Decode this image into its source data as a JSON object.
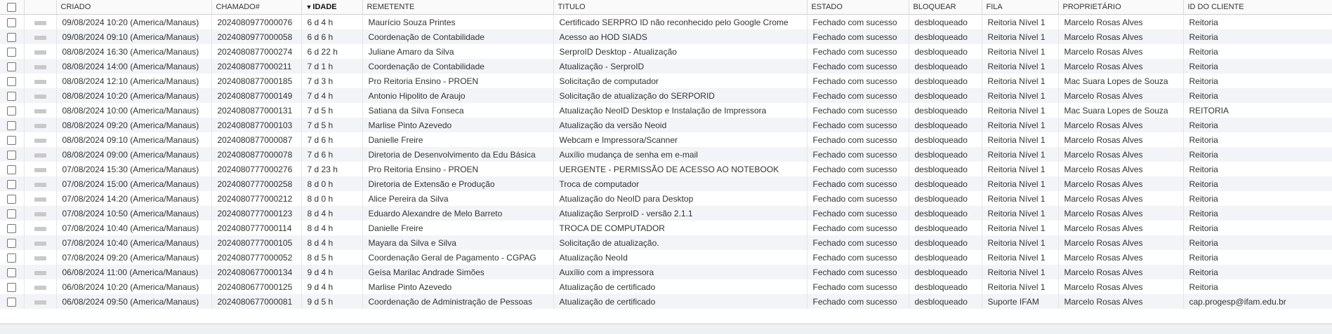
{
  "headers": {
    "created": "CRIADO",
    "ticket": "CHAMADO#",
    "age_sort_arrow": "▼",
    "age": "IDADE",
    "sender": "REMETENTE",
    "title": "TITULO",
    "state": "ESTADO",
    "lock": "BLOQUEAR",
    "queue": "FILA",
    "owner": "PROPRIETÁRIO",
    "customer_id": "ID DO CLIENTE"
  },
  "rows": [
    {
      "created": "09/08/2024 10:20 (America/Manaus)",
      "ticket": "2024080977000076",
      "age": "6 d 4 h",
      "sender": "Maurício Souza Printes",
      "title": "Certificado SERPRO ID não reconhecido pelo Google Crome",
      "state": "Fechado com sucesso",
      "lock": "desbloqueado",
      "queue": "Reitoria Nível 1",
      "owner": "Marcelo Rosas Alves",
      "customer_id": "Reitoria"
    },
    {
      "created": "09/08/2024 09:10 (America/Manaus)",
      "ticket": "2024080977000058",
      "age": "6 d 6 h",
      "sender": "Coordenação de Contabilidade",
      "title": "Acesso ao HOD SIADS",
      "state": "Fechado com sucesso",
      "lock": "desbloqueado",
      "queue": "Reitoria Nível 1",
      "owner": "Marcelo Rosas Alves",
      "customer_id": "Reitoria"
    },
    {
      "created": "08/08/2024 16:30 (America/Manaus)",
      "ticket": "2024080877000274",
      "age": "6 d 22 h",
      "sender": "Juliane Amaro da Silva",
      "title": "SerproID Desktop - Atualização",
      "state": "Fechado com sucesso",
      "lock": "desbloqueado",
      "queue": "Reitoria Nível 1",
      "owner": "Marcelo Rosas Alves",
      "customer_id": "Reitoria"
    },
    {
      "created": "08/08/2024 14:00 (America/Manaus)",
      "ticket": "2024080877000211",
      "age": "7 d 1 h",
      "sender": "Coordenação de Contabilidade",
      "title": "Atualização - SerproID",
      "state": "Fechado com sucesso",
      "lock": "desbloqueado",
      "queue": "Reitoria Nível 1",
      "owner": "Marcelo Rosas Alves",
      "customer_id": "Reitoria"
    },
    {
      "created": "08/08/2024 12:10 (America/Manaus)",
      "ticket": "2024080877000185",
      "age": "7 d 3 h",
      "sender": "Pro Reitoria Ensino - PROEN",
      "title": "Solicitação de computador",
      "state": "Fechado com sucesso",
      "lock": "desbloqueado",
      "queue": "Reitoria Nível 1",
      "owner": "Mac Suara Lopes de Souza",
      "customer_id": "Reitoria"
    },
    {
      "created": "08/08/2024 10:20 (America/Manaus)",
      "ticket": "2024080877000149",
      "age": "7 d 4 h",
      "sender": "Antonio Hipolito de Araujo",
      "title": "Solicitação de atualização do SERPORID",
      "state": "Fechado com sucesso",
      "lock": "desbloqueado",
      "queue": "Reitoria Nível 1",
      "owner": "Marcelo Rosas Alves",
      "customer_id": "Reitoria"
    },
    {
      "created": "08/08/2024 10:00 (America/Manaus)",
      "ticket": "2024080877000131",
      "age": "7 d 5 h",
      "sender": "Satiana da Silva Fonseca",
      "title": "Atualização NeoID Desktop e Instalação de Impressora",
      "state": "Fechado com sucesso",
      "lock": "desbloqueado",
      "queue": "Reitoria Nível 1",
      "owner": "Mac Suara Lopes de Souza",
      "customer_id": "REITORIA"
    },
    {
      "created": "08/08/2024 09:20 (America/Manaus)",
      "ticket": "2024080877000103",
      "age": "7 d 5 h",
      "sender": "Marlise Pinto Azevedo",
      "title": "Atualização da versão Neoid",
      "state": "Fechado com sucesso",
      "lock": "desbloqueado",
      "queue": "Reitoria Nível 1",
      "owner": "Marcelo Rosas Alves",
      "customer_id": "Reitoria"
    },
    {
      "created": "08/08/2024 09:10 (America/Manaus)",
      "ticket": "2024080877000087",
      "age": "7 d 6 h",
      "sender": "Danielle Freire",
      "title": "Webcam e Impressora/Scanner",
      "state": "Fechado com sucesso",
      "lock": "desbloqueado",
      "queue": "Reitoria Nível 1",
      "owner": "Marcelo Rosas Alves",
      "customer_id": "Reitoria"
    },
    {
      "created": "08/08/2024 09:00 (America/Manaus)",
      "ticket": "2024080877000078",
      "age": "7 d 6 h",
      "sender": "Diretoria de Desenvolvimento da Edu Básica",
      "title": "Auxílio mudança de senha em e-mail",
      "state": "Fechado com sucesso",
      "lock": "desbloqueado",
      "queue": "Reitoria Nível 1",
      "owner": "Marcelo Rosas Alves",
      "customer_id": "Reitoria"
    },
    {
      "created": "07/08/2024 15:30 (America/Manaus)",
      "ticket": "2024080777000276",
      "age": "7 d 23 h",
      "sender": "Pro Reitoria Ensino - PROEN",
      "title": "UERGENTE - PERMISSÃO DE ACESSO AO NOTEBOOK",
      "state": "Fechado com sucesso",
      "lock": "desbloqueado",
      "queue": "Reitoria Nível 1",
      "owner": "Marcelo Rosas Alves",
      "customer_id": "Reitoria"
    },
    {
      "created": "07/08/2024 15:00 (America/Manaus)",
      "ticket": "2024080777000258",
      "age": "8 d 0 h",
      "sender": "Diretoria de Extensão e Produção",
      "title": "Troca de computador",
      "state": "Fechado com sucesso",
      "lock": "desbloqueado",
      "queue": "Reitoria Nível 1",
      "owner": "Marcelo Rosas Alves",
      "customer_id": "Reitoria"
    },
    {
      "created": "07/08/2024 14:20 (America/Manaus)",
      "ticket": "2024080777000212",
      "age": "8 d 0 h",
      "sender": "Alice Pereira da Silva",
      "title": "Atualização do NeoID para Desktop",
      "state": "Fechado com sucesso",
      "lock": "desbloqueado",
      "queue": "Reitoria Nível 1",
      "owner": "Marcelo Rosas Alves",
      "customer_id": "Reitoria"
    },
    {
      "created": "07/08/2024 10:50 (America/Manaus)",
      "ticket": "2024080777000123",
      "age": "8 d 4 h",
      "sender": "Eduardo Alexandre de Melo Barreto",
      "title": "Atualização SerproID - versão 2.1.1",
      "state": "Fechado com sucesso",
      "lock": "desbloqueado",
      "queue": "Reitoria Nível 1",
      "owner": "Marcelo Rosas Alves",
      "customer_id": "Reitoria"
    },
    {
      "created": "07/08/2024 10:40 (America/Manaus)",
      "ticket": "2024080777000114",
      "age": "8 d 4 h",
      "sender": "Danielle Freire",
      "title": "TROCA DE COMPUTADOR",
      "state": "Fechado com sucesso",
      "lock": "desbloqueado",
      "queue": "Reitoria Nível 1",
      "owner": "Marcelo Rosas Alves",
      "customer_id": "Reitoria"
    },
    {
      "created": "07/08/2024 10:40 (America/Manaus)",
      "ticket": "2024080777000105",
      "age": "8 d 4 h",
      "sender": "Mayara da Silva e Silva",
      "title": "Solicitação de atualização.",
      "state": "Fechado com sucesso",
      "lock": "desbloqueado",
      "queue": "Reitoria Nível 1",
      "owner": "Marcelo Rosas Alves",
      "customer_id": "Reitoria"
    },
    {
      "created": "07/08/2024 09:20 (America/Manaus)",
      "ticket": "2024080777000052",
      "age": "8 d 5 h",
      "sender": "Coordenação Geral de Pagamento - CGPAG",
      "title": "Atualização NeoId",
      "state": "Fechado com sucesso",
      "lock": "desbloqueado",
      "queue": "Reitoria Nível 1",
      "owner": "Marcelo Rosas Alves",
      "customer_id": "Reitoria"
    },
    {
      "created": "06/08/2024 11:00 (America/Manaus)",
      "ticket": "2024080677000134",
      "age": "9 d 4 h",
      "sender": "Geísa Marilac Andrade Simões",
      "title": "Auxílio com a impressora",
      "state": "Fechado com sucesso",
      "lock": "desbloqueado",
      "queue": "Reitoria Nível 1",
      "owner": "Marcelo Rosas Alves",
      "customer_id": "Reitoria"
    },
    {
      "created": "06/08/2024 10:20 (America/Manaus)",
      "ticket": "2024080677000125",
      "age": "9 d 4 h",
      "sender": "Marlise Pinto Azevedo",
      "title": "Atualização de certificado",
      "state": "Fechado com sucesso",
      "lock": "desbloqueado",
      "queue": "Reitoria Nível 1",
      "owner": "Marcelo Rosas Alves",
      "customer_id": "Reitoria"
    },
    {
      "created": "06/08/2024 09:50 (America/Manaus)",
      "ticket": "2024080677000081",
      "age": "9 d 5 h",
      "sender": "Coordenação de Administração de Pessoas",
      "title": "Atualização de certificado",
      "state": "Fechado com sucesso",
      "lock": "desbloqueado",
      "queue": "Suporte IFAM",
      "owner": "Marcelo Rosas Alves",
      "customer_id": "cap.progesp@ifam.edu.br"
    }
  ]
}
